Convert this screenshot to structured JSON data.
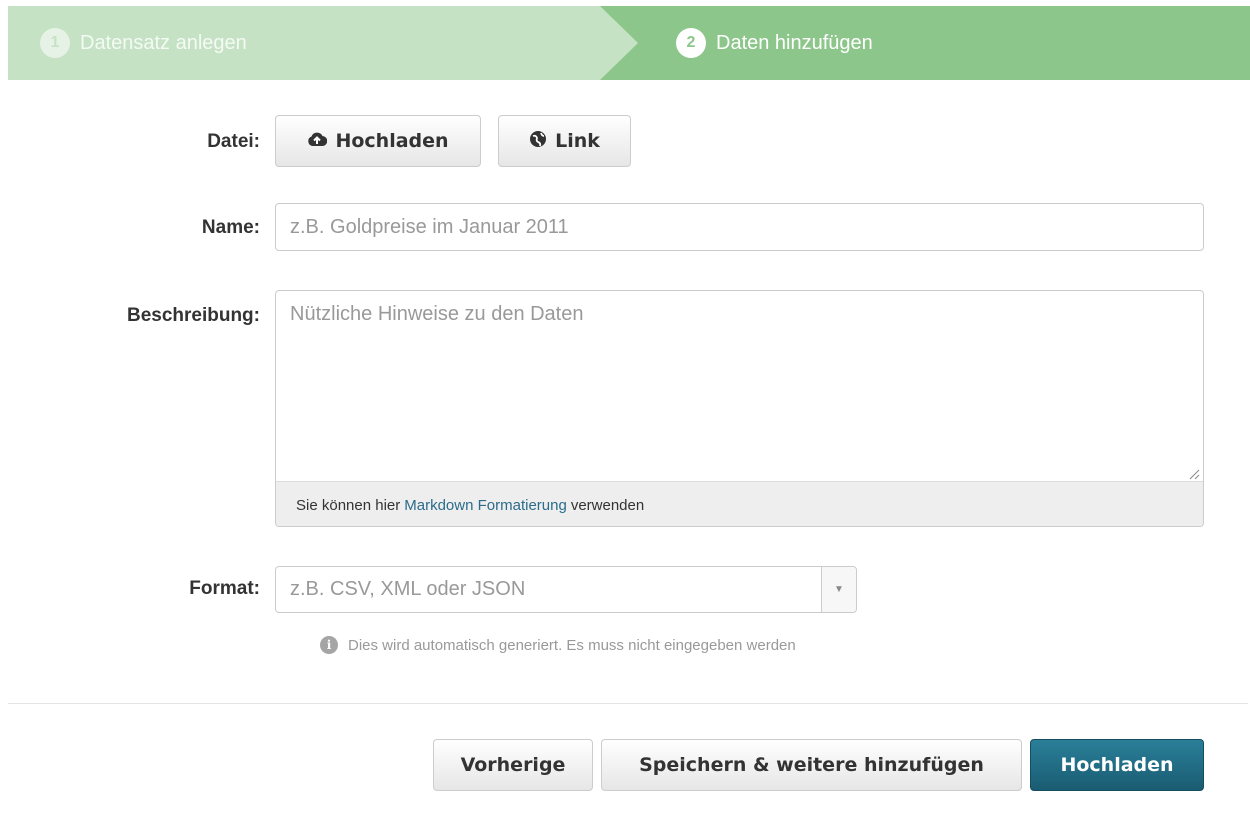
{
  "stages": [
    {
      "number": "1",
      "label": "Datensatz anlegen"
    },
    {
      "number": "2",
      "label": "Daten hinzufügen"
    }
  ],
  "form": {
    "file_label": "Datei:",
    "upload_button": "Hochladen",
    "link_button": "Link",
    "name_label": "Name:",
    "name_placeholder": "z.B. Goldpreise im Januar 2011",
    "description_label": "Beschreibung:",
    "description_placeholder": "Nützliche Hinweise zu den Daten",
    "markdown_hint_prefix": "Sie können hier",
    "markdown_hint_link": "Markdown Formatierung",
    "markdown_hint_suffix": "verwenden",
    "format_label": "Format:",
    "format_placeholder": "z.B. CSV, XML oder JSON",
    "format_help": "Dies wird automatisch generiert. Es muss nicht eingegeben werden"
  },
  "actions": {
    "previous": "Vorherige",
    "save_add_more": "Speichern & weitere hinzufügen",
    "upload": "Hochladen"
  },
  "icons": {
    "upload": "cloud-upload-icon",
    "link": "globe-icon",
    "info": "info-icon",
    "dropdown": "caret-down-icon"
  },
  "colors": {
    "stage_active": "#8cc68a",
    "stage_done": "#c6e2c4",
    "primary_button": "#1f6b82",
    "link": "#2b6c8b"
  }
}
